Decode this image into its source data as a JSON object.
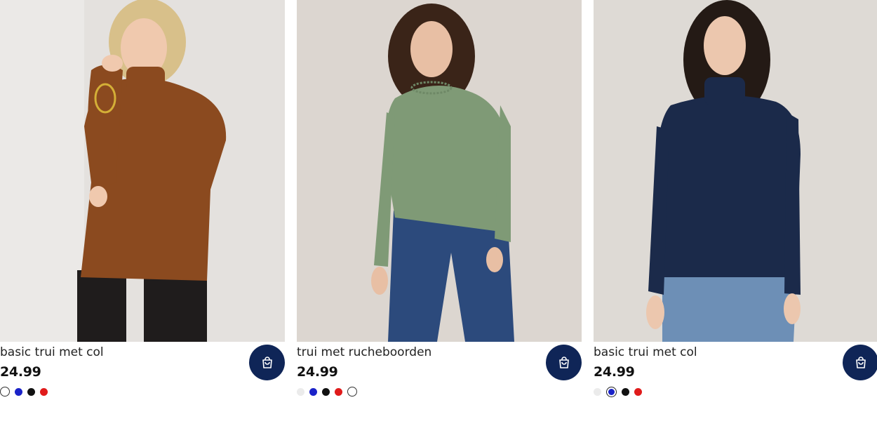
{
  "products": [
    {
      "name": "basic trui met col",
      "price": "24.99",
      "image": "woman-brown-turtleneck-photo",
      "sweater_color": "#8b4a1f",
      "swatches": [
        {
          "color": "#ffffff",
          "state": "outline"
        },
        {
          "color": "#1a22c8",
          "state": ""
        },
        {
          "color": "#111111",
          "state": ""
        },
        {
          "color": "#e01b1b",
          "state": ""
        }
      ]
    },
    {
      "name": "trui met rucheboorden",
      "price": "24.99",
      "image": "woman-green-ruffle-sweater-photo",
      "sweater_color": "#7f9a76",
      "swatches": [
        {
          "color": "#ebebeb",
          "state": ""
        },
        {
          "color": "#1a22c8",
          "state": ""
        },
        {
          "color": "#111111",
          "state": ""
        },
        {
          "color": "#e01b1b",
          "state": ""
        },
        {
          "color": "#ffffff",
          "state": "outline"
        }
      ]
    },
    {
      "name": "basic trui met col",
      "price": "24.99",
      "image": "woman-navy-turtleneck-photo",
      "sweater_color": "#1b2a4a",
      "swatches": [
        {
          "color": "#ebebeb",
          "state": ""
        },
        {
          "color": "#1a22c8",
          "state": "sel"
        },
        {
          "color": "#111111",
          "state": ""
        },
        {
          "color": "#e01b1b",
          "state": ""
        }
      ]
    }
  ],
  "cart_icon": "shopping-bag-icon",
  "colors": {
    "cart_button_bg": "#0f2557"
  }
}
